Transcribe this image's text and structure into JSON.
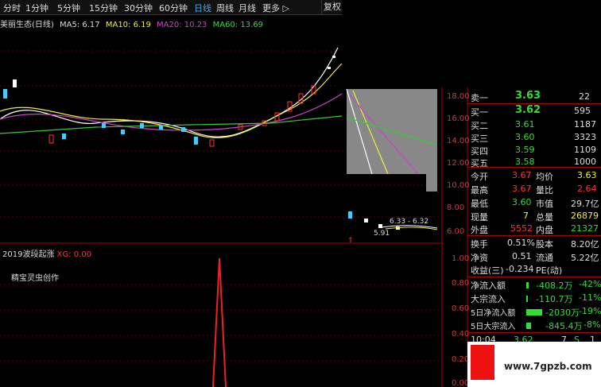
{
  "toolbar": {
    "items": [
      "分时",
      "1分钟",
      "5分钟",
      "15分钟",
      "30分钟",
      "60分钟",
      "日线",
      "周线",
      "月线",
      "更多 ▷"
    ],
    "active": "日线",
    "restore": "复权"
  },
  "legend": {
    "name": "美丽生态(日线)",
    "ma5": "MA5: 6.17",
    "ma10": "MA10: 6.19",
    "ma20": "MA20: 10.23",
    "ma60": "MA60: 13.69"
  },
  "price_axis": [
    "18.00",
    "16.00",
    "14.00",
    "12.00",
    "10.00",
    "8.00",
    "6.00"
  ],
  "annotations": {
    "high_label": "6.33 - 6.32",
    "low_label": "5.91"
  },
  "indicator": {
    "title": "2019波段起涨",
    "xg": "XG: 0.00",
    "note": "精宝灵虫创作",
    "axis": [
      "1.00",
      "0.80",
      "0.60",
      "0.40",
      "0.20",
      "0.00"
    ]
  },
  "quote": {
    "sell1": {
      "label": "卖一",
      "price": "3.63",
      "vol": "22"
    },
    "buys": [
      {
        "label": "买一",
        "price": "3.62",
        "vol": "595"
      },
      {
        "label": "买二",
        "price": "3.61",
        "vol": "1187"
      },
      {
        "label": "买三",
        "price": "3.60",
        "vol": "3323"
      },
      {
        "label": "买四",
        "price": "3.59",
        "vol": "1109"
      },
      {
        "label": "买五",
        "price": "3.58",
        "vol": "1000"
      }
    ],
    "stats": [
      {
        "l1": "今开",
        "v1": "3.67",
        "l2": "均价",
        "v2": "3.63"
      },
      {
        "l1": "最高",
        "v1": "3.67",
        "l2": "量比",
        "v2": "2.64"
      },
      {
        "l1": "最低",
        "v1": "3.60",
        "l2": "市值",
        "v2": "29.7亿"
      },
      {
        "l1": "现量",
        "v1": "7",
        "l2": "总量",
        "v2": "26879"
      },
      {
        "l1": "外盘",
        "v1": "5552",
        "l2": "内盘",
        "v2": "21327"
      },
      {
        "l1": "换手",
        "v1": "0.51%",
        "l2": "股本",
        "v2": "8.20亿"
      },
      {
        "l1": "净资",
        "v1": "0.51",
        "l2": "流通",
        "v2": "5.22亿"
      },
      {
        "l1": "收益(三)",
        "v1": "-0.234",
        "l2": "PE(动)",
        "v2": ""
      }
    ],
    "flows": [
      {
        "label": "净流入额",
        "value": "-408.2万",
        "pct": "-42%",
        "bar": 0.1
      },
      {
        "label": "大宗流入",
        "value": "-110.7万",
        "pct": "-11%",
        "bar": 0.02
      },
      {
        "label": "5日净流入额",
        "value": "-2030万",
        "pct": "-19%",
        "bar": 0.7
      },
      {
        "label": "5日大宗流入",
        "value": "-845.4万",
        "pct": "-8%",
        "bar": 0.2
      }
    ],
    "tick": {
      "time": "10:04",
      "price": "3.62",
      "vol": "7",
      "side": "S",
      "count": "1"
    }
  },
  "watermark": {
    "text": "www.7gpzb.com"
  },
  "colors": {
    "up": "#ff3333",
    "down": "#33dd33",
    "ma5": "#ffffff",
    "ma10": "#eeee33",
    "ma20": "#cc44cc",
    "ma60": "#33cc33"
  }
}
